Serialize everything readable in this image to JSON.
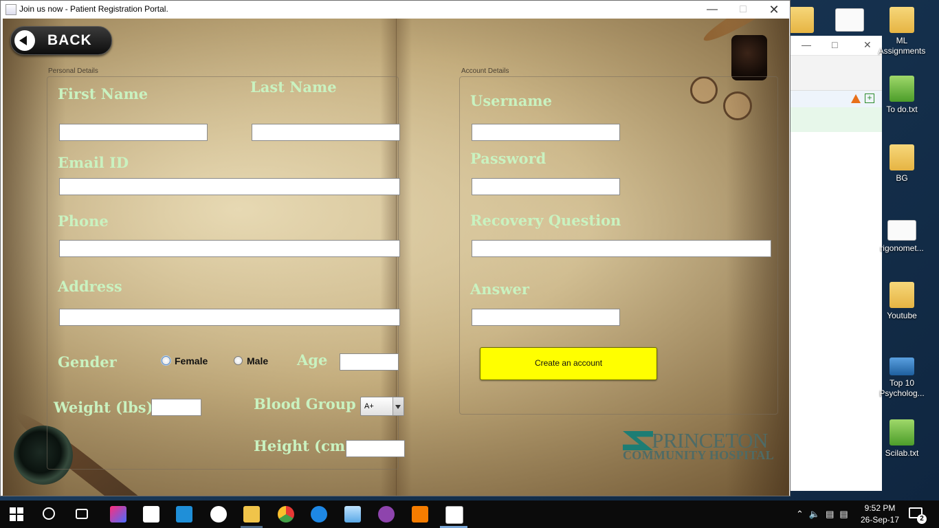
{
  "window": {
    "title": "Join us now - Patient Registration Portal."
  },
  "back_button": {
    "label": "BACK"
  },
  "personal_details": {
    "group_title": "Personal Details",
    "first_name_label": "First Name",
    "last_name_label": "Last Name",
    "email_label": "Email ID",
    "phone_label": "Phone",
    "address_label": "Address",
    "gender_label": "Gender",
    "gender_options": [
      "Female",
      "Male"
    ],
    "age_label": "Age",
    "weight_label": "Weight (lbs)",
    "blood_group_label": "Blood Group",
    "blood_group_value": "A+",
    "height_label": "Height (cm)"
  },
  "account_details": {
    "group_title": "Account Details",
    "username_label": "Username",
    "password_label": "Password",
    "recovery_question_label": "Recovery Question",
    "answer_label": "Answer",
    "create_button_label": "Create an account"
  },
  "logo": {
    "line1": "PRINCETON",
    "line2": "COMMUNITY HOSPITAL"
  },
  "desktop": {
    "icons": [
      {
        "label": "ML Assignments",
        "icon": "folder-icon"
      },
      {
        "label": "To do.txt",
        "icon": "text-file-icon"
      },
      {
        "label": "BG",
        "icon": "folder-icon"
      },
      {
        "label": "rigonomet...",
        "icon": "document-icon"
      },
      {
        "label": "Youtube",
        "icon": "folder-icon"
      },
      {
        "label": "Top 10 Psycholog...",
        "icon": "video-icon"
      },
      {
        "label": "Scilab.txt",
        "icon": "text-file-icon"
      }
    ]
  },
  "taskbar": {
    "time": "9:52 PM",
    "date": "26-Sep-17",
    "notification_count": "2"
  },
  "colors": {
    "label_green": "#c9f2c0",
    "create_button": "#ffff00",
    "logo_teal": "#1d7d74"
  }
}
